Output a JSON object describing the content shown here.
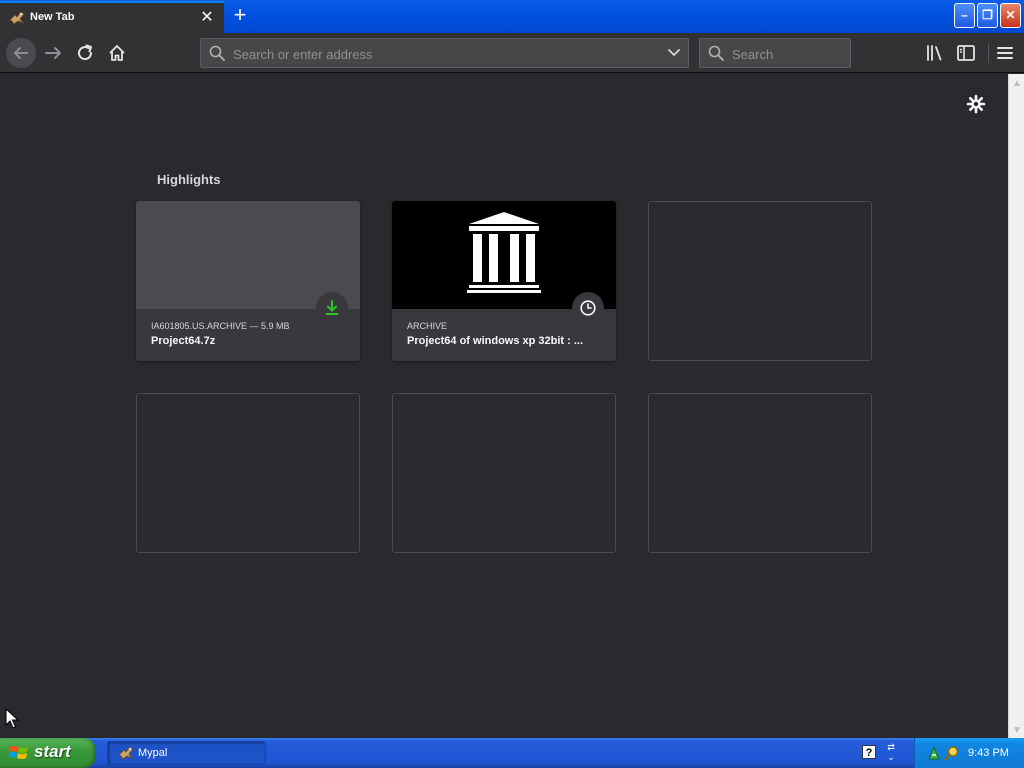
{
  "browser": {
    "tab": {
      "title": "New Tab",
      "close_glyph": "✕"
    },
    "new_tab_glyph": "+",
    "window_controls": {
      "min_glyph": "–",
      "max_glyph": "❐",
      "close_glyph": "✕"
    },
    "toolbar": {
      "url_placeholder": "Search or enter address",
      "search_placeholder": "Search"
    }
  },
  "content": {
    "section_title": "Highlights",
    "cards": [
      {
        "source": "IA601805.US.ARCHIVE — 5.9 MB",
        "title": "Project64.7z",
        "badge": "download-icon"
      },
      {
        "source": "ARCHIVE",
        "title": "Project64 of windows xp 32bit : ...",
        "badge": "history-icon"
      }
    ]
  },
  "taskbar": {
    "start_label": "start",
    "task_button": "Mypal",
    "help_glyph": "?",
    "clock": "9:43 PM"
  },
  "colors": {
    "accent": "#0a84ff",
    "content_bg": "#2a2a2e",
    "download_green": "#2ac62a"
  }
}
